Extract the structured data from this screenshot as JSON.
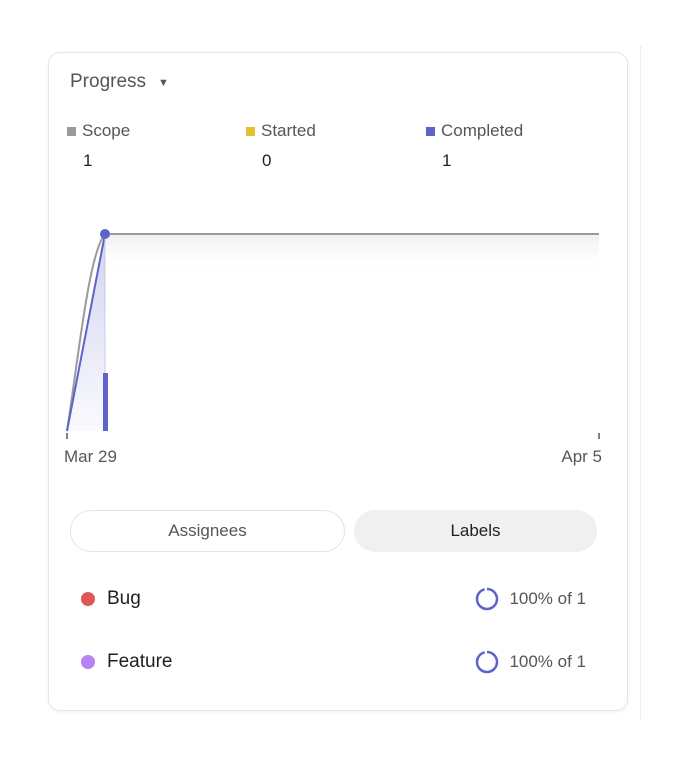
{
  "header": {
    "title": "Progress",
    "caret_icon": "caret-down-icon"
  },
  "stats": [
    {
      "label": "Scope",
      "value": "1",
      "color": "#9a9a9e"
    },
    {
      "label": "Started",
      "value": "0",
      "color": "#e5c031"
    },
    {
      "label": "Completed",
      "value": "1",
      "color": "#5e63c9"
    }
  ],
  "chart_data": {
    "type": "line",
    "x_ticks": [
      "Mar 29",
      "Apr 5"
    ],
    "series": [
      {
        "name": "Scope",
        "color": "#9a9a9e",
        "points": [
          [
            "Mar 29",
            1
          ],
          [
            "Apr 5",
            1
          ]
        ]
      },
      {
        "name": "Completed",
        "color": "#5e63c9",
        "points": [
          [
            "Mar 29",
            1
          ]
        ]
      }
    ],
    "ylim": [
      0,
      1
    ]
  },
  "tabs": {
    "assignees": "Assignees",
    "labels": "Labels",
    "active": "Labels"
  },
  "labels": [
    {
      "name": "Bug",
      "color": "#e05757",
      "progress": "100% of 1"
    },
    {
      "name": "Feature",
      "color": "#b583f5",
      "progress": "100% of 1"
    }
  ]
}
